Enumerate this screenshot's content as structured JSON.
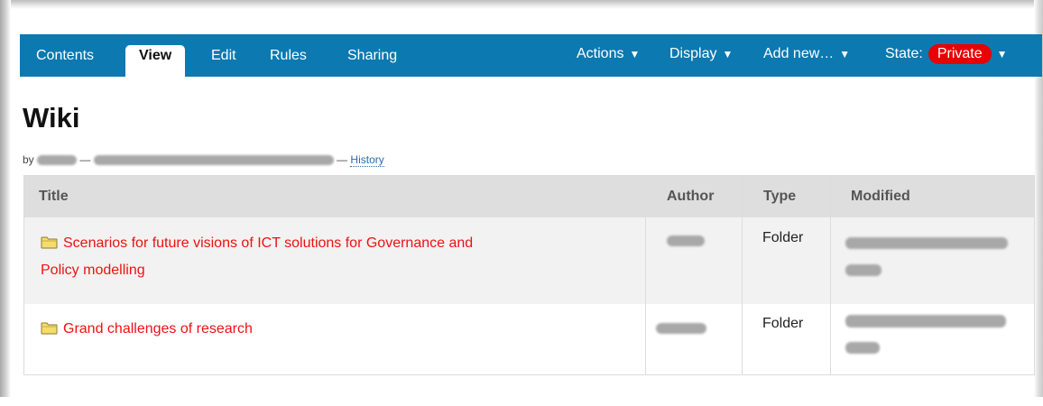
{
  "toolbar": {
    "tabs": [
      {
        "label": "Contents",
        "active": false
      },
      {
        "label": "View",
        "active": true
      },
      {
        "label": "Edit",
        "active": false
      },
      {
        "label": "Rules",
        "active": false
      },
      {
        "label": "Sharing",
        "active": false
      }
    ],
    "menus": {
      "actions": "Actions",
      "display": "Display",
      "add_new": "Add new…",
      "state_label": "State:",
      "state_value": "Private"
    },
    "caret": "▼",
    "colors": {
      "bar": "#0c79b0",
      "state_pill": "#e90000"
    }
  },
  "page": {
    "title": "Wiki",
    "byline_prefix": "by",
    "separator": "—",
    "history_link": "History"
  },
  "listing": {
    "headers": {
      "title": "Title",
      "author": "Author",
      "type": "Type",
      "modified": "Modified"
    },
    "rows": [
      {
        "title_line1": "Scenarios for future visions of ICT solutions for Governance and",
        "title_line2": "Policy modelling",
        "type": "Folder",
        "icon": "folder-icon"
      },
      {
        "title_line1": "Grand challenges of research",
        "type": "Folder",
        "icon": "folder-icon"
      }
    ],
    "link_color": "#ee1111"
  }
}
